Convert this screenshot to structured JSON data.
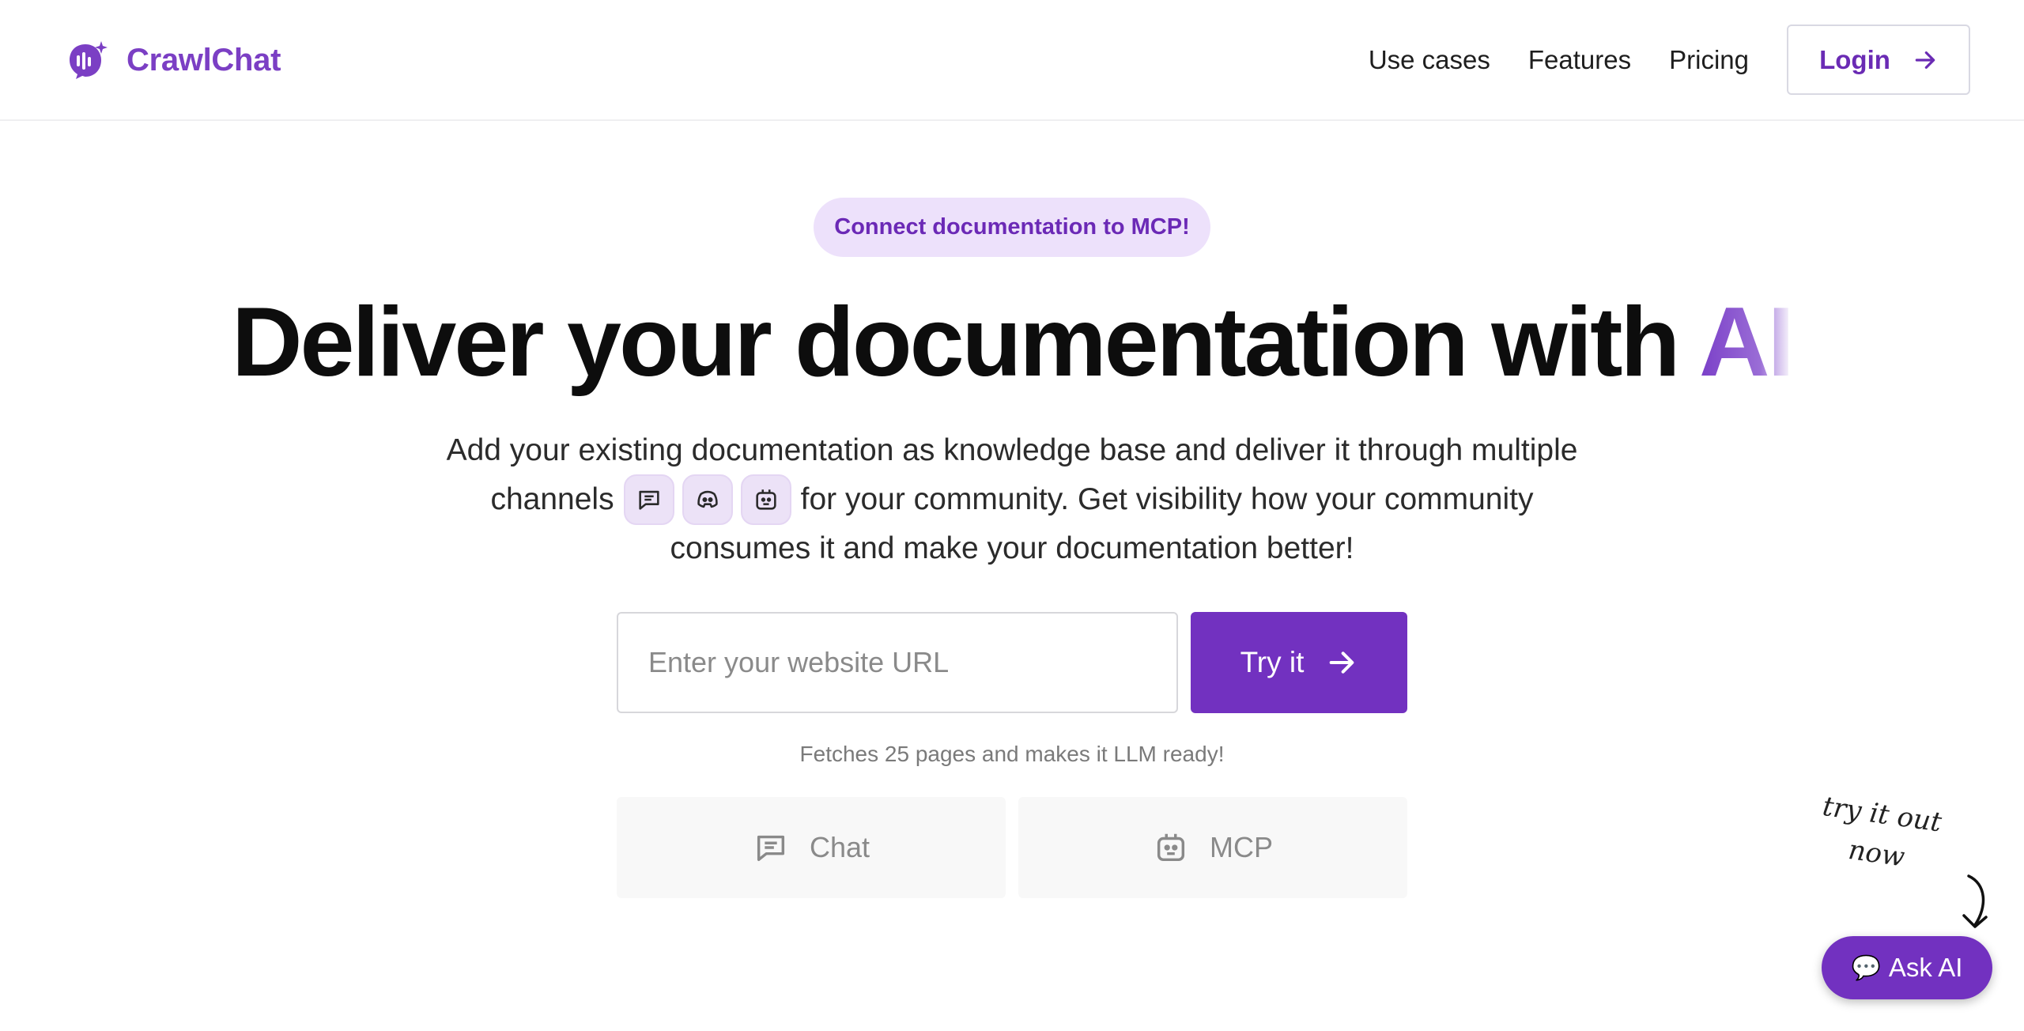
{
  "brand": {
    "name": "CrawlChat",
    "accent": "#7231c0",
    "accent_light": "#ede1fb"
  },
  "nav": {
    "links": [
      "Use cases",
      "Features",
      "Pricing"
    ],
    "login_label": "Login"
  },
  "hero": {
    "pill": "Connect documentation to MCP!",
    "headline_main": "Deliver your documentation with ",
    "headline_accent": "AI",
    "sub_line1": "Add your existing documentation as knowledge base and deliver it through multiple",
    "sub_line2_before": "channels",
    "sub_line2_after": "for your community. Get visibility how your community",
    "sub_line3": "consumes it and make your documentation better!",
    "channel_icons": [
      "chat-icon",
      "discord-icon",
      "mcp-icon"
    ]
  },
  "form": {
    "placeholder": "Enter your website URL",
    "value": "",
    "try_label": "Try it",
    "note": "Fetches 25 pages and makes it LLM ready!"
  },
  "tabs": [
    {
      "icon": "chat-icon",
      "label": "Chat"
    },
    {
      "icon": "mcp-icon",
      "label": "MCP"
    }
  ],
  "widget": {
    "hint_line1": "try it out",
    "hint_line2": "now",
    "ask_label": "Ask AI",
    "ask_icon": "💬"
  }
}
